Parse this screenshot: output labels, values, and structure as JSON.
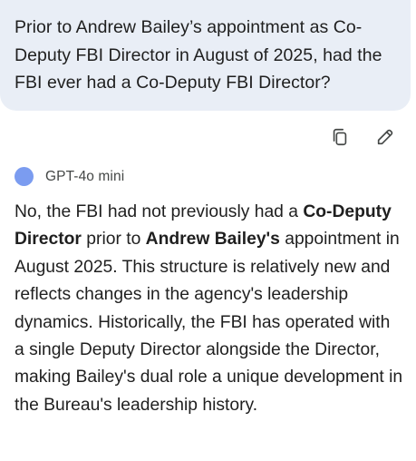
{
  "user_message": {
    "text": "Prior to Andrew Bailey’s appointment as Co-Deputy FBI Director in August of 2025, had the FBI ever had a Co-Deputy FBI Director?"
  },
  "actions": {
    "copy_icon": "copy-icon",
    "edit_icon": "edit-pencil-icon"
  },
  "model": {
    "name": "GPT-4o mini",
    "dot_color": "#7b9cf0"
  },
  "response": {
    "part1": "No, the FBI had not previously had a ",
    "bold1": "Co-Deputy Director",
    "part2": " prior to ",
    "bold2": "Andrew Bailey's",
    "part3": " appointment in August 2025. This structure is relatively new and reflects changes in the agency's leadership dynamics. Historically, the FBI has operated with a single Deputy Director alongside the Director, making Bailey's dual role a unique development in the Bureau's leadership history."
  }
}
